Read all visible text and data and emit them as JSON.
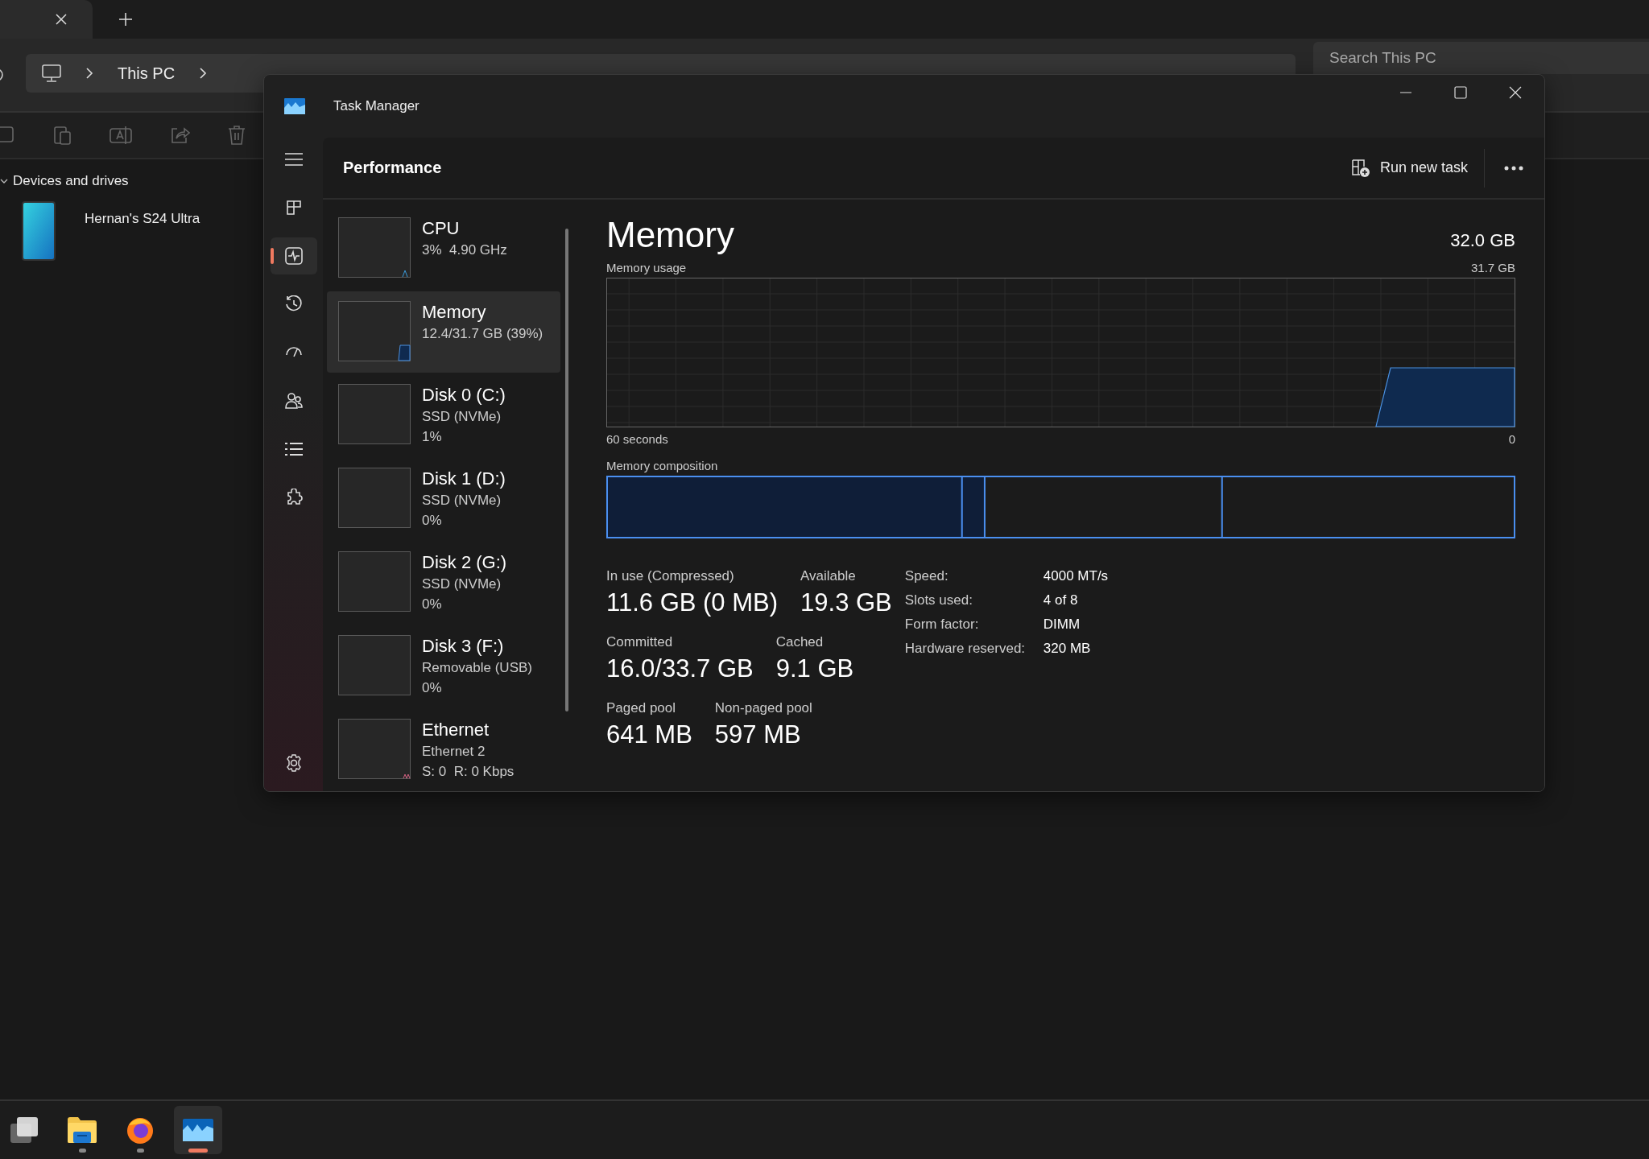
{
  "explorer": {
    "breadcrumb": [
      "This PC"
    ],
    "search": {
      "placeholder": "Search This PC"
    },
    "section": {
      "label": "Devices and drives",
      "expanded": true
    },
    "devices": [
      {
        "name": "Hernan's S24 Ultra"
      }
    ]
  },
  "task_manager": {
    "title": "Task Manager",
    "nav": [
      {
        "kind": "menu",
        "selected": false
      },
      {
        "kind": "processes",
        "selected": false
      },
      {
        "kind": "performance",
        "selected": true
      },
      {
        "kind": "history",
        "selected": false
      },
      {
        "kind": "startup",
        "selected": false
      },
      {
        "kind": "users",
        "selected": false
      },
      {
        "kind": "details",
        "selected": false
      },
      {
        "kind": "services",
        "selected": false
      },
      {
        "kind": "settings",
        "selected": false
      }
    ],
    "page_title": "Performance",
    "run_new_task": "Run new task",
    "resources": [
      {
        "kind": "cpu",
        "name": "CPU",
        "details": [
          "3%  4.90 GHz"
        ],
        "selected": false
      },
      {
        "kind": "memory",
        "name": "Memory",
        "details": [
          "12.4/31.7 GB (39%)"
        ],
        "selected": true
      },
      {
        "kind": "disk",
        "name": "Disk 0 (C:)",
        "details": [
          "SSD (NVMe)",
          "1%"
        ],
        "selected": false
      },
      {
        "kind": "disk",
        "name": "Disk 1 (D:)",
        "details": [
          "SSD (NVMe)",
          "0%"
        ],
        "selected": false
      },
      {
        "kind": "disk",
        "name": "Disk 2 (G:)",
        "details": [
          "SSD (NVMe)",
          "0%"
        ],
        "selected": false
      },
      {
        "kind": "disk",
        "name": "Disk 3 (F:)",
        "details": [
          "Removable (USB)",
          "0%"
        ],
        "selected": false
      },
      {
        "kind": "ethernet",
        "name": "Ethernet",
        "details": [
          "Ethernet 2",
          "S: 0  R: 0 Kbps"
        ],
        "selected": false
      }
    ],
    "detail": {
      "title": "Memory",
      "total": "32.0 GB",
      "usage_label": "Memory usage",
      "usage_max": "31.7 GB",
      "axis_start": "60 seconds",
      "axis_end": "0",
      "composition_label": "Memory composition",
      "stats": [
        [
          {
            "label": "In use (Compressed)",
            "value": "11.6 GB (0 MB)"
          },
          {
            "label": "Available",
            "value": "19.3 GB"
          }
        ],
        [
          {
            "label": "Committed",
            "value": "16.0/33.7 GB"
          },
          {
            "label": "Cached",
            "value": "9.1 GB"
          }
        ],
        [
          {
            "label": "Paged pool",
            "value": "641 MB"
          },
          {
            "label": "Non-paged pool",
            "value": "597 MB"
          }
        ]
      ],
      "specs": [
        {
          "label": "Speed:",
          "value": "4000 MT/s"
        },
        {
          "label": "Slots used:",
          "value": "4 of 8"
        },
        {
          "label": "Form factor:",
          "value": "DIMM"
        },
        {
          "label": "Hardware reserved:",
          "value": "320 MB"
        }
      ]
    }
  },
  "taskbar": [
    {
      "kind": "task-view",
      "running": false,
      "selected": false
    },
    {
      "kind": "folder",
      "running": true,
      "selected": false
    },
    {
      "kind": "browser",
      "running": true,
      "selected": false
    },
    {
      "kind": "task-manager",
      "running": true,
      "selected": true
    }
  ]
}
